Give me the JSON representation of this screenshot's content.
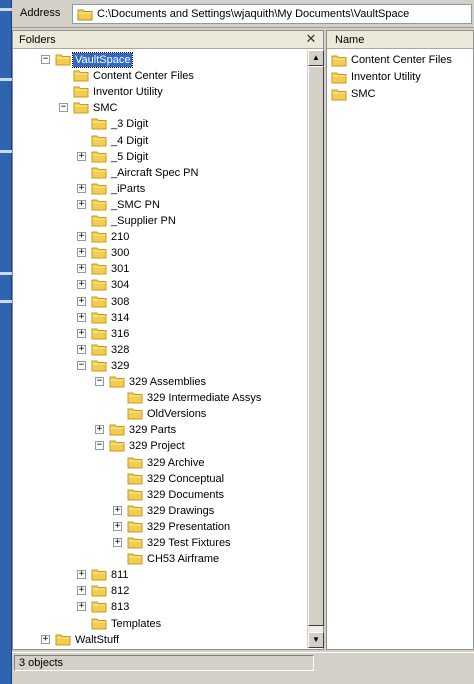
{
  "address": {
    "label": "Address",
    "path": "C:\\Documents and Settings\\wjaquith\\My Documents\\VaultSpace"
  },
  "folders_pane": {
    "title": "Folders",
    "close_icon": "close-icon",
    "tree": [
      {
        "label": "VaultSpace",
        "depth": 0,
        "expander": "-",
        "selected": true
      },
      {
        "label": "Content Center Files",
        "depth": 1,
        "expander": ""
      },
      {
        "label": "Inventor Utility",
        "depth": 1,
        "expander": ""
      },
      {
        "label": "SMC",
        "depth": 1,
        "expander": "-"
      },
      {
        "label": "_3 Digit",
        "depth": 2,
        "expander": ""
      },
      {
        "label": "_4 Digit",
        "depth": 2,
        "expander": ""
      },
      {
        "label": "_5 Digit",
        "depth": 2,
        "expander": "+"
      },
      {
        "label": "_Aircraft Spec PN",
        "depth": 2,
        "expander": ""
      },
      {
        "label": "_iParts",
        "depth": 2,
        "expander": "+"
      },
      {
        "label": "_SMC PN",
        "depth": 2,
        "expander": "+"
      },
      {
        "label": "_Supplier PN",
        "depth": 2,
        "expander": ""
      },
      {
        "label": "210",
        "depth": 2,
        "expander": "+"
      },
      {
        "label": "300",
        "depth": 2,
        "expander": "+"
      },
      {
        "label": "301",
        "depth": 2,
        "expander": "+"
      },
      {
        "label": "304",
        "depth": 2,
        "expander": "+"
      },
      {
        "label": "308",
        "depth": 2,
        "expander": "+"
      },
      {
        "label": "314",
        "depth": 2,
        "expander": "+"
      },
      {
        "label": "316",
        "depth": 2,
        "expander": "+"
      },
      {
        "label": "328",
        "depth": 2,
        "expander": "+"
      },
      {
        "label": "329",
        "depth": 2,
        "expander": "-"
      },
      {
        "label": "329 Assemblies",
        "depth": 3,
        "expander": "-"
      },
      {
        "label": "329 Intermediate Assys",
        "depth": 4,
        "expander": ""
      },
      {
        "label": "OldVersions",
        "depth": 4,
        "expander": ""
      },
      {
        "label": "329 Parts",
        "depth": 3,
        "expander": "+"
      },
      {
        "label": "329 Project",
        "depth": 3,
        "expander": "-"
      },
      {
        "label": "329 Archive",
        "depth": 4,
        "expander": ""
      },
      {
        "label": "329 Conceptual",
        "depth": 4,
        "expander": ""
      },
      {
        "label": "329 Documents",
        "depth": 4,
        "expander": ""
      },
      {
        "label": "329 Drawings",
        "depth": 4,
        "expander": "+"
      },
      {
        "label": "329 Presentation",
        "depth": 4,
        "expander": "+"
      },
      {
        "label": "329 Test Fixtures",
        "depth": 4,
        "expander": "+"
      },
      {
        "label": "CH53 Airframe",
        "depth": 4,
        "expander": ""
      },
      {
        "label": "811",
        "depth": 2,
        "expander": "+"
      },
      {
        "label": "812",
        "depth": 2,
        "expander": "+"
      },
      {
        "label": "813",
        "depth": 2,
        "expander": "+"
      },
      {
        "label": "Templates",
        "depth": 2,
        "expander": ""
      },
      {
        "label": "WaltStuff",
        "depth": 0,
        "expander": "+"
      }
    ]
  },
  "contents_pane": {
    "column_name": "Name",
    "items": [
      "Content Center Files",
      "Inventor Utility",
      "SMC"
    ]
  },
  "status": {
    "text": "3 objects"
  },
  "colors": {
    "folder": "#f2cd4f",
    "folder_dark": "#c99a1c",
    "selection": "#316ac5"
  }
}
